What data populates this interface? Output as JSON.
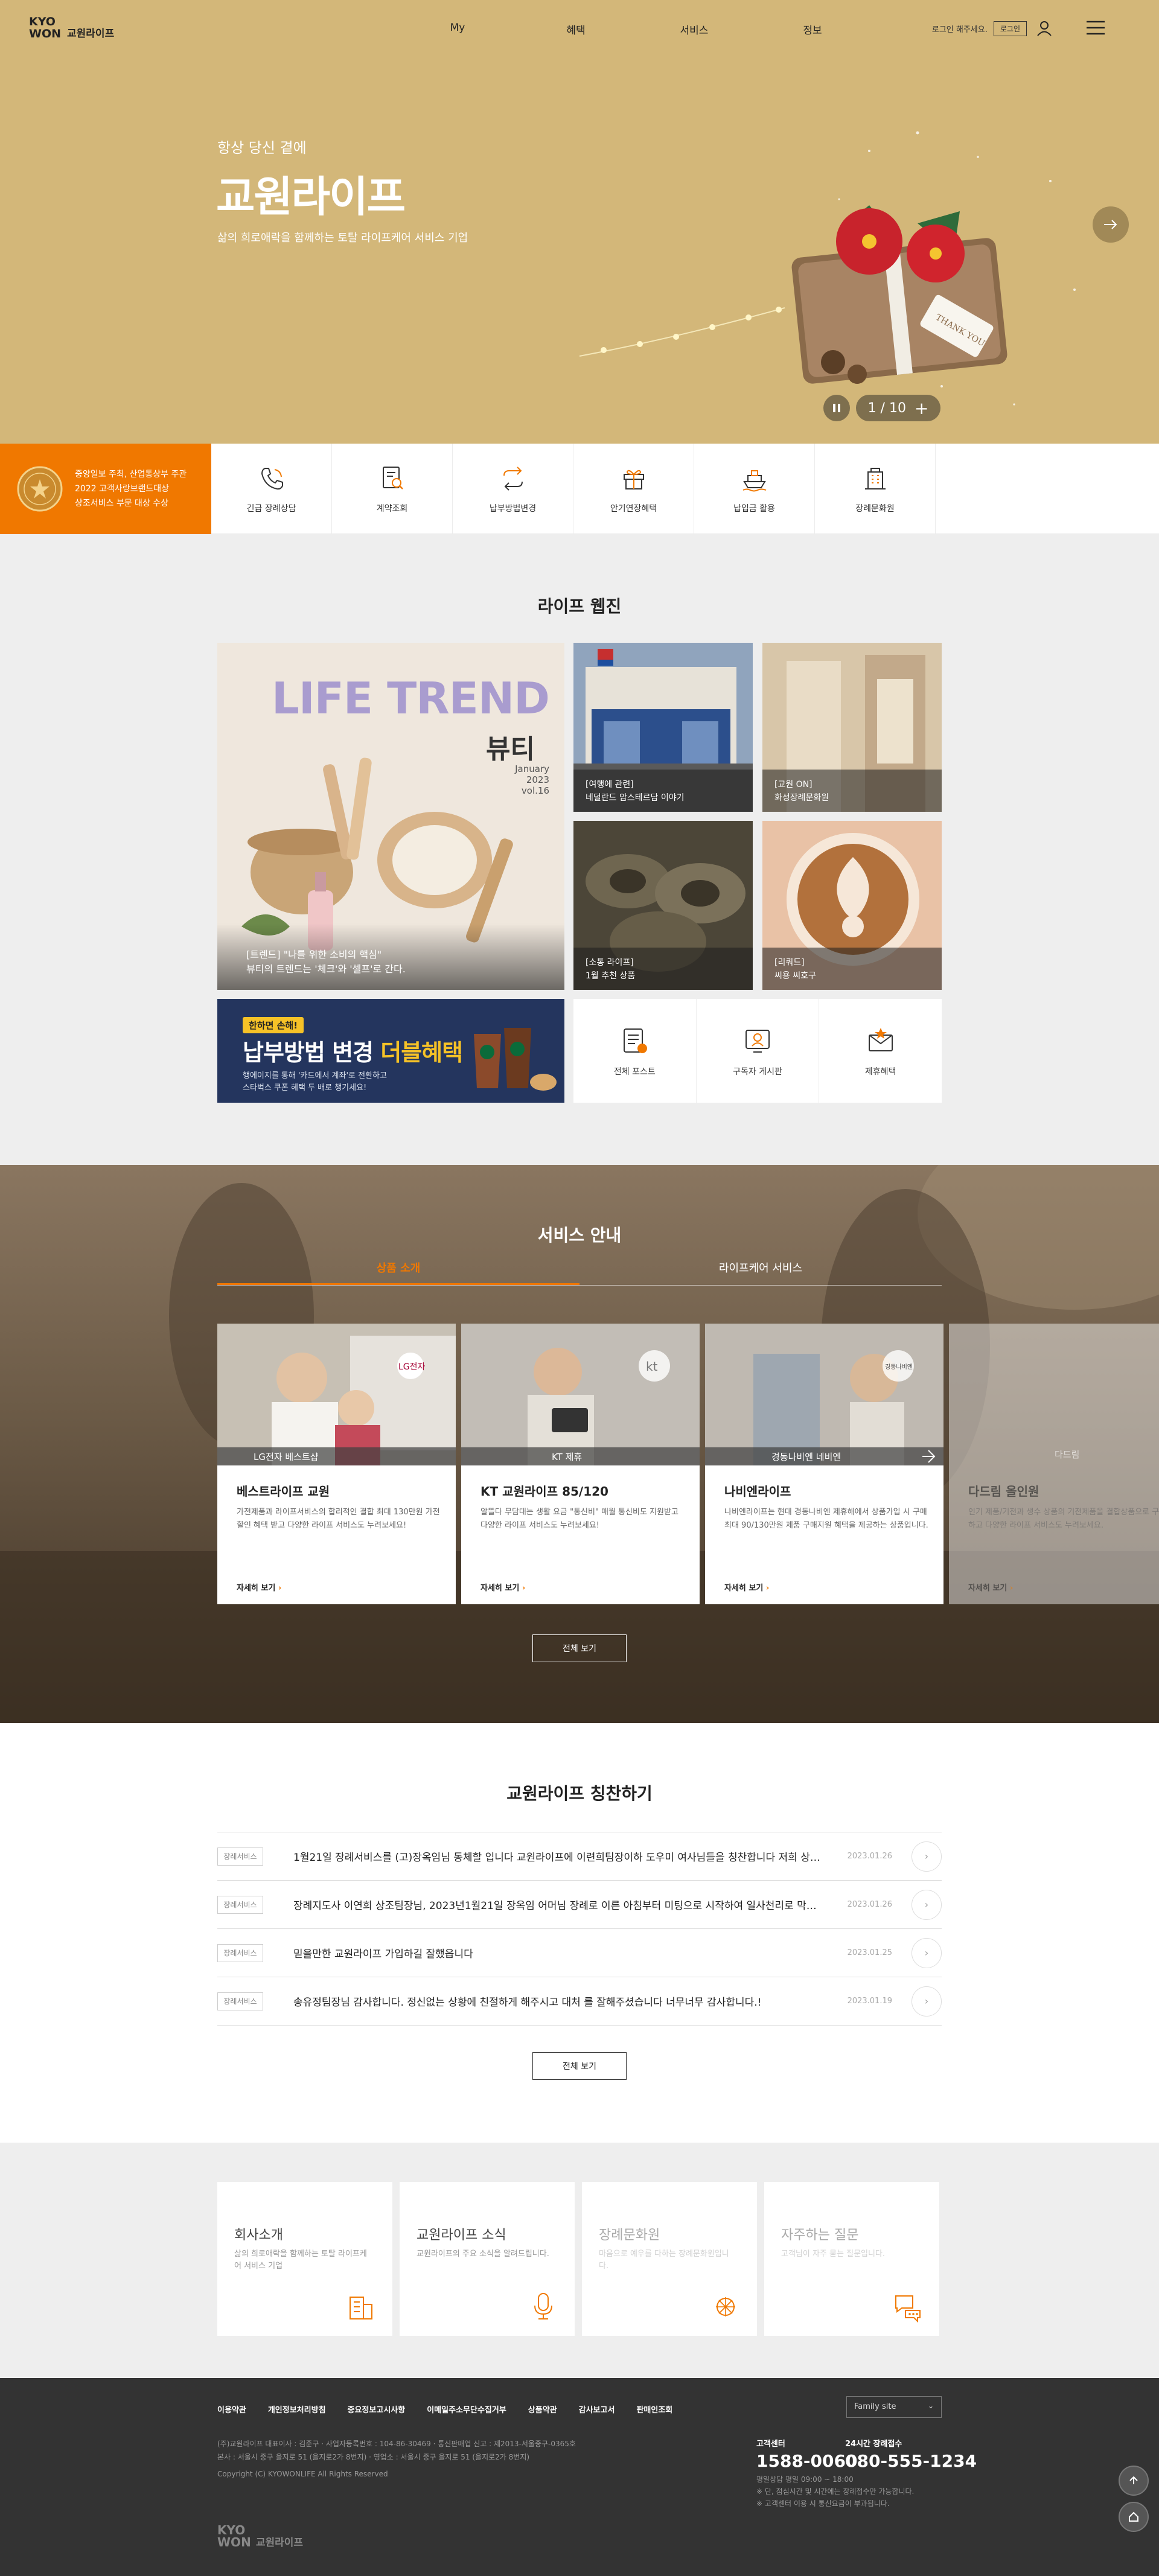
{
  "header": {
    "logo_line1": "KYO",
    "logo_line2": "WON",
    "logo_name": "교원라이프",
    "nav": [
      "My",
      "혜택",
      "서비스",
      "정보"
    ],
    "login_msg": "로그인 해주세요.",
    "login_button": "로그인"
  },
  "hero": {
    "subtitle": "항상 당신 곁에",
    "title": "교원라이프",
    "desc": "삶의 희로애락을 함께하는 토탈 라이프케어 서비스 기업",
    "card_text": "THANK YOU",
    "pager_current": "1",
    "pager_total": "10",
    "pager": "1 / 10"
  },
  "award": {
    "line1": "중앙일보 주최, 산업통상부 주관",
    "line2": "2022 고객사랑브랜드대상",
    "line3": "상조서비스 부문 대상 수상"
  },
  "quick_menu": [
    {
      "label": "긴급 장례상담",
      "icon": "phone-icon"
    },
    {
      "label": "계약조회",
      "icon": "document-search-icon"
    },
    {
      "label": "납부방법변경",
      "icon": "exchange-icon"
    },
    {
      "label": "안기연장혜택",
      "icon": "gift-icon"
    },
    {
      "label": "납입금 활용",
      "icon": "cruise-icon"
    },
    {
      "label": "장례문화원",
      "icon": "building-icon"
    }
  ],
  "webzine": {
    "title": "라이프 웹진",
    "main": {
      "headline": "LIFE TREND",
      "category": "뷰티",
      "month": "January",
      "year": "2023",
      "vol": "vol.16",
      "caption1": "[트렌드] \"나를 위한 소비의 핵심\"",
      "caption2": "뷰티의 트렌드는 '체크'와 '셀프'로 간다."
    },
    "items": [
      {
        "cap1": "[여행에 관련]",
        "cap2": "네덜란드 암스테르담 이야기"
      },
      {
        "cap1": "[교원 ON]",
        "cap2": "화성장례문화원"
      },
      {
        "cap1": "[소통 라이프]",
        "cap2": "1월 추천 상품"
      },
      {
        "cap1": "[리쿼드]",
        "cap2": "씨용 씨호구"
      }
    ],
    "banner": {
      "tag": "한하면 손해!",
      "headline_a": "납부방법 변경",
      "headline_b": "더블혜택",
      "desc1": "행에이지를 통해 '카드에서 계좌'로 전환하고",
      "desc2": "스타벅스 쿠폰 혜택 두 배로 챙기세요!"
    },
    "links": [
      {
        "label": "전체 포스트",
        "icon": "post-list-icon"
      },
      {
        "label": "구독자 게시판",
        "icon": "subscriber-board-icon"
      },
      {
        "label": "제휴혜택",
        "icon": "partner-mail-icon"
      }
    ]
  },
  "service": {
    "title": "서비스 안내",
    "tabs": [
      "상품 소개",
      "라이프케어 서비스"
    ],
    "cards": [
      {
        "name": "베스트라이프 교원",
        "desc": "가전제품과 라이프서비스의 합리적인 결합 최대 130만원 가전 할인 혜택 받고 다양한 라이프 서비스도 누려보세요!",
        "more": "자세히 보기",
        "brand": "LG전자",
        "overlay": "LG전자 베스트샵"
      },
      {
        "name": "KT 교원라이프 85/120",
        "desc": "알뜰다 무담대는 생활 요금 \"통신비\" 매월 통신비도 지원받고 다양한 라이프 서비스도 누려보세요!",
        "more": "자세히 보기",
        "brand": "kt",
        "overlay": "KT 제휴"
      },
      {
        "name": "나비엔라이프",
        "desc": "나비엔라이프는 현대 경동나비엔 제휴해에서 상품가입 시 구매최대 90/130만원 제품 구매지원 혜택을 제공하는 상품입니다.",
        "more": "자세히 보기",
        "brand": "경동나비엔",
        "overlay": "경동나비엔 네비엔"
      },
      {
        "name": "다드림 올인원",
        "desc": "인기 제품/기전과 생수 상품의 기전제품을 결합상품으로 구매하고 다양한 라이프 서비스도 누려보세요.",
        "more": "자세히 보기",
        "brand": "",
        "overlay": "다드림"
      }
    ],
    "all_button": "전체 보기"
  },
  "praise": {
    "title": "교원라이프 칭찬하기",
    "rows": [
      {
        "tag": "장례서비스",
        "title": "1월21일 장례서비스를 (고)장옥임님 동체할 입니다 교원라이프에 이련희팀장이하 도우미 여사님들을 칭찬합니다 저희 상주들...",
        "date": "2023.01.26"
      },
      {
        "tag": "장례서비스",
        "title": "장례지도사 이연희 상조팀장님, 2023년1월21일 장옥임 어머님 장례로 이른 아침부터 미팅으로 시작하여 일사천리로 막힘없는...",
        "date": "2023.01.26"
      },
      {
        "tag": "장례서비스",
        "title": "믿을만한 교원라이프 가입하길 잘했읍니다",
        "date": "2023.01.25"
      },
      {
        "tag": "장례서비스",
        "title": "송유정팀장님 감사합니다. 정신없는 상황에 친절하게 해주시고 대처 를 잘해주셨습니다 너무너무 감사합니다.!",
        "date": "2023.01.19"
      }
    ],
    "all_button": "전체 보기"
  },
  "info_cards": [
    {
      "title": "회사소개",
      "desc": "삶의 희로애락을 함께하는 토탈 라이프케어 서비스 기업",
      "icon": "company-building-icon"
    },
    {
      "title": "교원라이프 소식",
      "desc": "교원라이프의 주요 소식을 알려드립니다.",
      "icon": "microphone-icon"
    },
    {
      "title": "장례문화원",
      "desc": "마음으로 예우를 다하는 장례문화원입니다.",
      "icon": "lotus-icon"
    },
    {
      "title": "자주하는 질문",
      "desc": "고객님이 자주 묻는 질문입니다.",
      "icon": "chat-bubble-icon"
    }
  ],
  "footer": {
    "links": [
      "이용약관",
      "개인정보처리방침",
      "중요정보고시사항",
      "이메일주소무단수집거부",
      "상품약관",
      "감사보고서",
      "판매인조회"
    ],
    "family_site": "Family site",
    "info1": "(주)교원라이프 대표이사 : 김준구 · 사업자등록번호 : 104-86-30469 · 통신판매업 신고 : 제2013-서울중구-0365호",
    "info2": "본사 : 서울시 중구 을지로 51 (을지로2가 8번지) · 영업소 : 서울시 중구 을지로 51 (을지로2가 8번지)",
    "copyright": "Copyright (C) KYOWONLIFE All Rights Reserved",
    "cs1_label": "고객센터",
    "cs1_number": "1588-0060",
    "cs2_label": "24시간 장례접수",
    "cs2_number": "080-555-1234",
    "cs_note1": "평일상담 평일 09:00 ~ 18:00",
    "cs_note2": "※ 단, 점심시간 및 시간에는 장례접수만 가능합니다.",
    "cs_note3": "※ 고객센터 이용 시 통신요금이 부과됩니다.",
    "logo_line1": "KYO",
    "logo_line2": "WON",
    "logo_name": "교원라이프"
  },
  "colors": {
    "accent": "#f07800",
    "hero_bg": "#d3b779",
    "footer_bg": "#333333"
  }
}
